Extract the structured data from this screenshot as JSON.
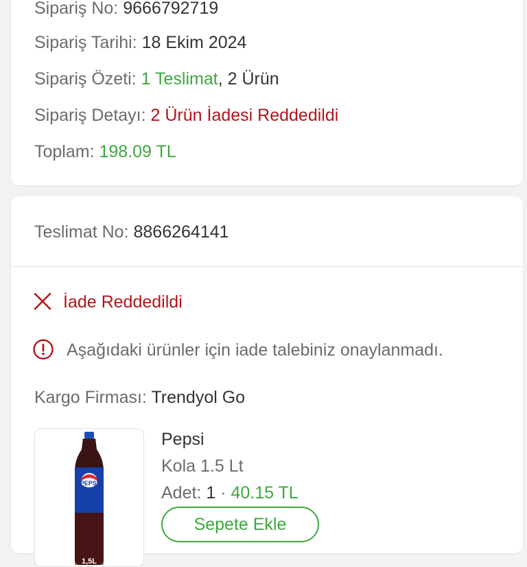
{
  "order": {
    "number_label": "Sipariş No:",
    "number_value": "9666792719",
    "date_label": "Sipariş Tarihi:",
    "date_value": "18 Ekim 2024",
    "summary_label": "Sipariş Özeti:",
    "summary_deliveries": "1 Teslimat",
    "summary_items": ", 2 Ürün",
    "detail_label": "Sipariş Detayı:",
    "detail_value": "2 Ürün İadesi Reddedildi",
    "total_label": "Toplam:",
    "total_value": "198.09 TL"
  },
  "delivery": {
    "number_label": "Teslimat No:",
    "number_value": "8866264141",
    "status_text": "İade Reddedildi",
    "info_text": "Aşağıdaki ürünler için iade talebiniz onaylanmadı.",
    "carrier_label": "Kargo Firması:",
    "carrier_value": "Trendyol Go"
  },
  "product": {
    "brand": "Pepsi",
    "name": "Kola 1.5 Lt",
    "qty_label": "Adet:",
    "qty_value": "1",
    "separator": "·",
    "price": "40.15 TL",
    "bottle_logo": "PEPSI",
    "bottle_size": "1,5L",
    "add_to_cart_label": "Sepete Ekle"
  },
  "icons": {
    "status": "close-x-icon",
    "info": "info-circle-icon"
  },
  "colors": {
    "accent_green": "#3da83f",
    "error_red": "#b3151c",
    "label_gray": "#6b6b6b",
    "text_dark": "#333333"
  }
}
